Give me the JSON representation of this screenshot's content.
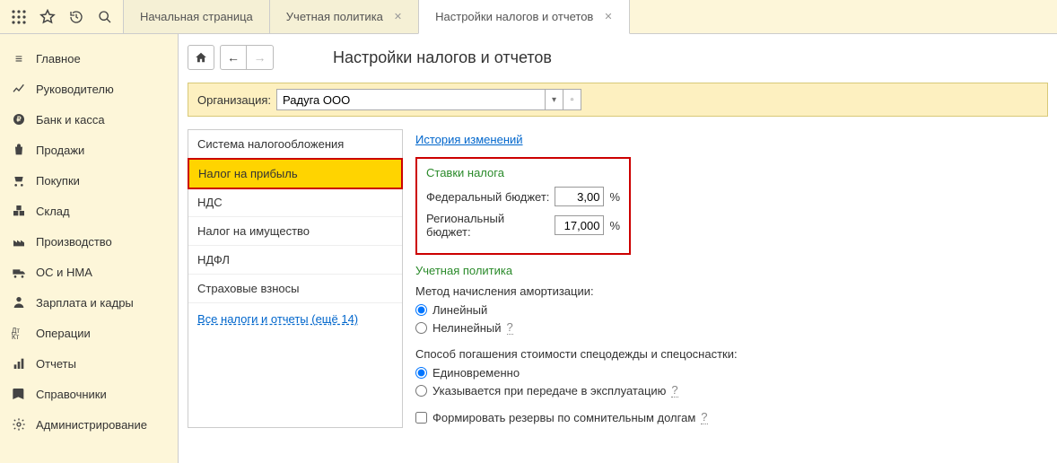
{
  "tabs": [
    {
      "label": "Начальная страница",
      "closable": false
    },
    {
      "label": "Учетная политика",
      "closable": true
    },
    {
      "label": "Настройки налогов и отчетов",
      "closable": true,
      "active": true
    }
  ],
  "sidebar": {
    "items": [
      {
        "label": "Главное"
      },
      {
        "label": "Руководителю"
      },
      {
        "label": "Банк и касса"
      },
      {
        "label": "Продажи"
      },
      {
        "label": "Покупки"
      },
      {
        "label": "Склад"
      },
      {
        "label": "Производство"
      },
      {
        "label": "ОС и НМА"
      },
      {
        "label": "Зарплата и кадры"
      },
      {
        "label": "Операции"
      },
      {
        "label": "Отчеты"
      },
      {
        "label": "Справочники"
      },
      {
        "label": "Администрирование"
      }
    ]
  },
  "page": {
    "title": "Настройки налогов и отчетов",
    "org_label": "Организация:",
    "org_value": "Радуга ООО"
  },
  "navlist": {
    "items": [
      "Система налогообложения",
      "Налог на прибыль",
      "НДС",
      "Налог на имущество",
      "НДФЛ",
      "Страховые взносы"
    ],
    "selected_index": 1,
    "more_link": "Все налоги и отчеты (ещё 14)"
  },
  "detail": {
    "history_link": "История изменений",
    "rates_title": "Ставки налога",
    "federal_label": "Федеральный бюджет:",
    "federal_value": "3,00",
    "regional_label": "Региональный бюджет:",
    "regional_value": "17,000",
    "pct": "%",
    "policy_title": "Учетная политика",
    "amort_label": "Метод начисления амортизации:",
    "amort_linear": "Линейный",
    "amort_nonlinear": "Нелинейный",
    "special_label": "Способ погашения стоимости спецодежды и спецоснастки:",
    "special_once": "Единовременно",
    "special_transfer": "Указывается при передаче в эксплуатацию",
    "reserves_label": "Формировать резервы по сомнительным долгам",
    "help": "?"
  }
}
